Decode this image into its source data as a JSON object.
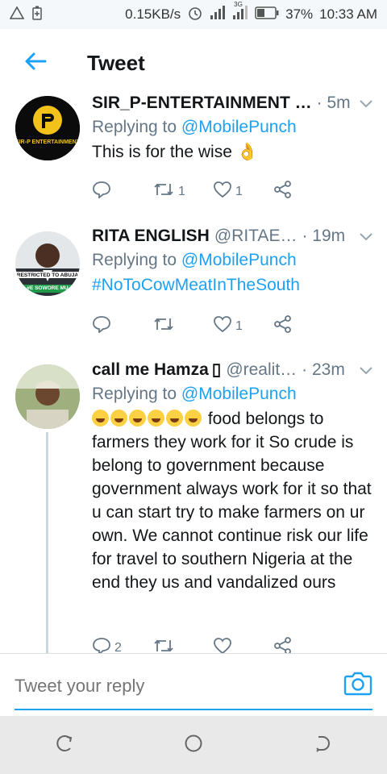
{
  "status_bar": {
    "network_speed": "0.15KB/s",
    "network_type": "3G",
    "battery": "37%",
    "time": "10:33 AM",
    "icons": [
      "alert-icon",
      "battery-saver-icon",
      "alarm-icon",
      "signal-icon",
      "signal-3g-icon",
      "battery-icon"
    ]
  },
  "header": {
    "title": "Tweet",
    "back_icon": "arrow-left-icon"
  },
  "tweets": [
    {
      "name": "SIR_P-ENTERTAINMENT …",
      "handle": "",
      "time": "· 5m",
      "replying_prefix": "Replying to",
      "replying_to": "@MobilePunch",
      "text": "This is for the wise 👌",
      "avatar_text": "SIR-P ENTERTAINMENT",
      "replies": "",
      "retweets": "1",
      "likes": "1"
    },
    {
      "name": "RITA ENGLISH",
      "handle": "@RITAE…",
      "time": "· 19m",
      "replying_prefix": "Replying to",
      "replying_to": "@MobilePunch",
      "text": "#NoToCowMeatInTheSouth",
      "avatar_text_top": "RESTRICTED TO ABUJA",
      "avatar_text_bottom": "#E SOWORE MU",
      "replies": "",
      "retweets": "",
      "likes": "1"
    },
    {
      "name": "call me Hamza",
      "name_glyph": "▯",
      "handle": "@realit…",
      "time": "· 23m",
      "replying_prefix": "Replying to",
      "replying_to": "@MobilePunch",
      "text": "food belongs to farmers they work for it So crude is belong to government because government always work for it so that u can start try to make farmers on ur own. We cannot continue risk our life for travel to southern Nigeria at the end they us and vandalized ours",
      "emoji_count": 6,
      "replies": "2",
      "retweets": "",
      "likes": ""
    }
  ],
  "composer": {
    "placeholder": "Tweet your reply",
    "camera_icon": "camera-icon"
  },
  "nav_bar": {
    "icons": [
      "recent-apps-icon",
      "home-icon",
      "back-icon"
    ]
  },
  "colors": {
    "accent": "#1da1f2",
    "secondary_text": "#657786",
    "divider": "#d8dee3"
  }
}
